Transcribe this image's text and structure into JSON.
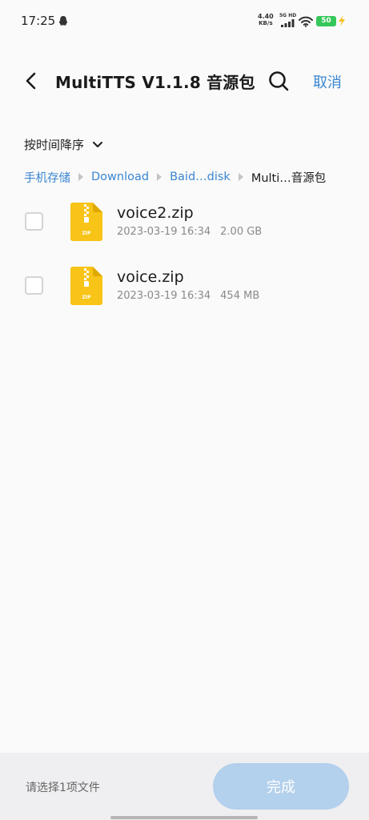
{
  "status_bar": {
    "time": "17:25",
    "net_speed_value": "4.40",
    "net_speed_unit": "KB/s",
    "signal_label": "5G HD",
    "battery_level": "50",
    "icons": [
      "qq-icon",
      "signal-icon",
      "wifi-icon",
      "battery-icon",
      "charge-icon"
    ]
  },
  "header": {
    "title": "MultiTTS V1.1.8 音源包",
    "cancel_label": "取消",
    "icons": [
      "back-icon",
      "search-icon"
    ]
  },
  "sort": {
    "label": "按时间降序"
  },
  "breadcrumb": [
    {
      "label": "手机存储"
    },
    {
      "label": "Download"
    },
    {
      "label": "Baid…disk"
    },
    {
      "label": "Multi…音源包"
    }
  ],
  "files": [
    {
      "name": "voice2.zip",
      "date": "2023-03-19 16:34",
      "size": "2.00 GB",
      "icon_text": "ZIP",
      "checked": false
    },
    {
      "name": "voice.zip",
      "date": "2023-03-19 16:34",
      "size": "454 MB",
      "icon_text": "ZIP",
      "checked": false
    }
  ],
  "bottom_bar": {
    "hint": "请选择1项文件",
    "done_label": "完成"
  },
  "colors": {
    "accent": "#3a86d1",
    "done_disabled": "#b3d0ec",
    "zip_yellow": "#f7c417",
    "battery_green": "#34c759"
  }
}
